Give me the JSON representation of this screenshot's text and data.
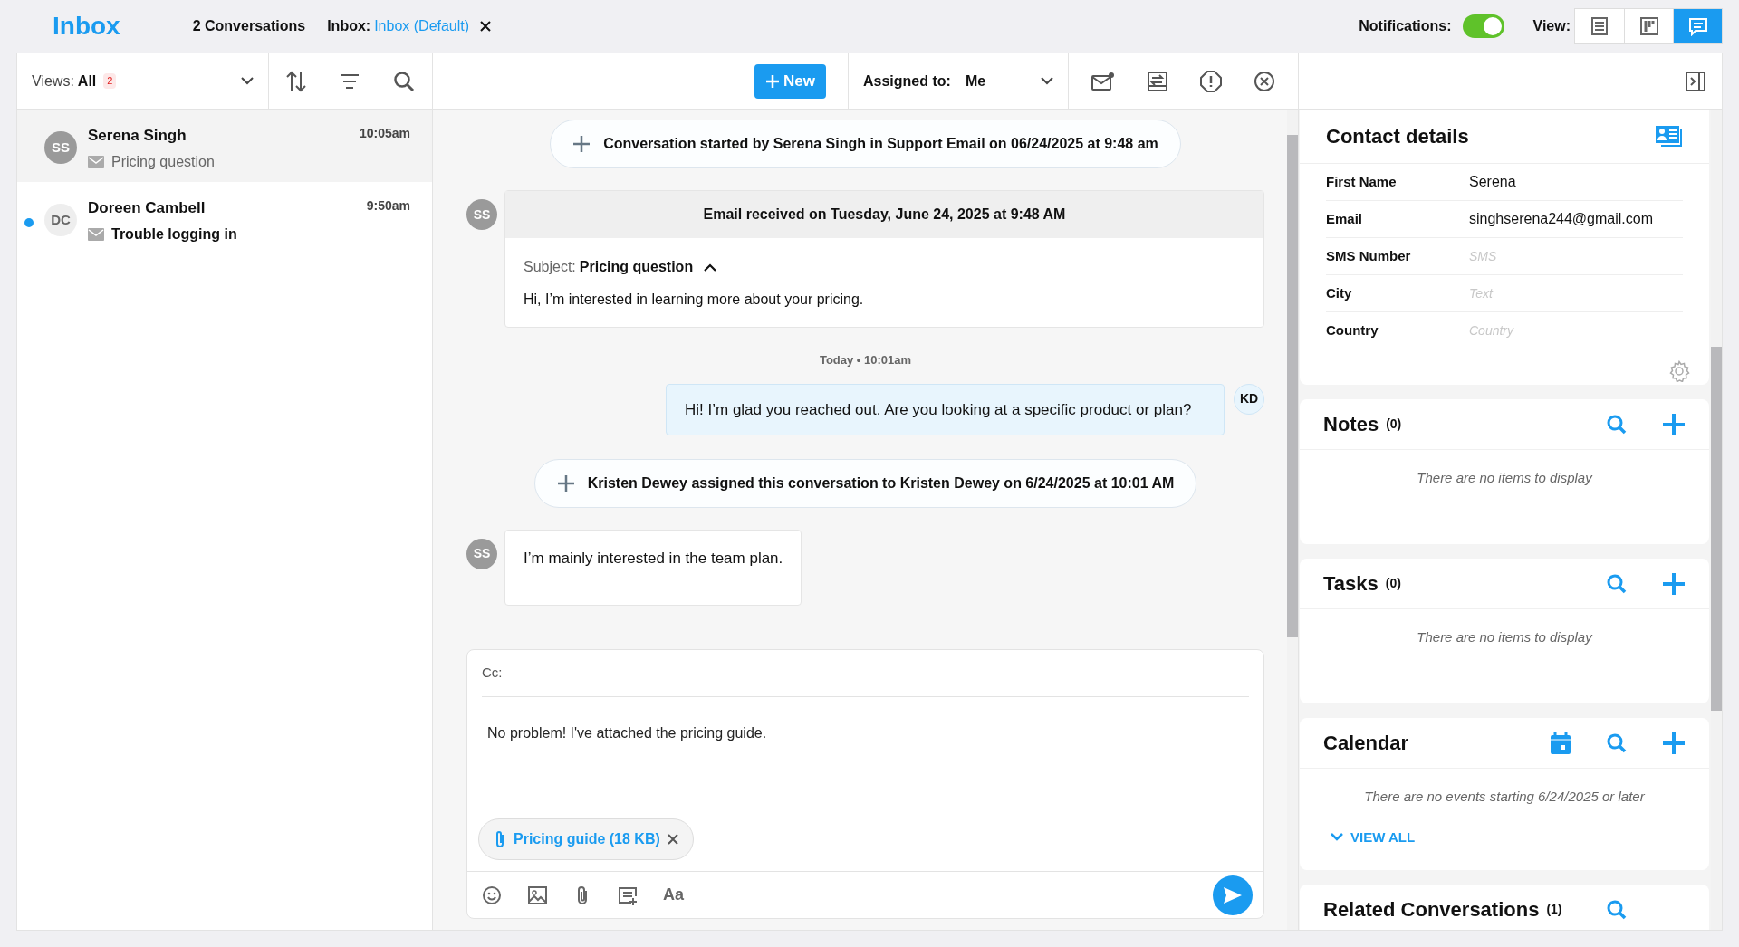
{
  "header": {
    "title": "Inbox",
    "count": "2 Conversations",
    "inbox_label": "Inbox:",
    "inbox_value": "Inbox (Default)",
    "notifications_label": "Notifications:",
    "notifications_on": true,
    "view_label": "View:",
    "views": [
      {
        "kind": "list",
        "selected": false
      },
      {
        "kind": "board",
        "selected": false
      },
      {
        "kind": "chat",
        "selected": true
      }
    ]
  },
  "list_toolbar": {
    "views_label": "Views:",
    "views_value": "All",
    "badge": "2"
  },
  "conversations": [
    {
      "initials": "SS",
      "name": "Serena Singh",
      "time": "10:05am",
      "subject": "Pricing question",
      "unread": false,
      "selected": true
    },
    {
      "initials": "DC",
      "name": "Doreen Cambell",
      "time": "9:50am",
      "subject": "Trouble logging in",
      "unread": true,
      "selected": false
    }
  ],
  "toolbar": {
    "new_label": "New",
    "assigned_label": "Assigned to:",
    "assigned_value": "Me"
  },
  "messages": [
    {
      "kind": "event",
      "text": "Conversation started by Serena Singh in Support Email on 06/24/2025 at 9:48 am"
    },
    {
      "kind": "email",
      "initials": "SS",
      "header": "Email received on Tuesday, June 24, 2025 at 9:48 AM",
      "subject_label": "Subject:",
      "subject": "Pricing question",
      "body": "Hi, I’m interested in learning more about your pricing."
    },
    {
      "kind": "timestamp",
      "text": "Today • 10:01am"
    },
    {
      "kind": "outgoing",
      "initials": "KD",
      "text": "Hi! I’m glad you reached out. Are you looking at a specific product or plan?"
    },
    {
      "kind": "event",
      "text": "Kristen Dewey assigned this conversation to Kristen Dewey on 6/24/2025 at 10:01 AM"
    },
    {
      "kind": "incoming",
      "initials": "SS",
      "text": "I’m mainly interested in the team plan."
    }
  ],
  "composer": {
    "cc_label": "Cc:",
    "body": "No problem! I've attached the pricing guide.",
    "attachment": "Pricing guide (18 KB)",
    "tools": [
      {
        "kind": "emoji"
      },
      {
        "kind": "image"
      },
      {
        "kind": "attach"
      },
      {
        "kind": "template"
      },
      {
        "kind": "format",
        "label": "Aa"
      }
    ]
  },
  "contact": {
    "title": "Contact details",
    "fields": [
      {
        "label": "First Name",
        "value": "Serena"
      },
      {
        "label": "Email",
        "value": "singhserena244@gmail.com"
      },
      {
        "label": "SMS Number",
        "placeholder": "SMS"
      },
      {
        "label": "City",
        "placeholder": "Text"
      },
      {
        "label": "Country",
        "placeholder": "Country"
      }
    ]
  },
  "panels": [
    {
      "kind": "notes",
      "title": "Notes",
      "count": "(0)",
      "empty": "There are no items to display"
    },
    {
      "kind": "tasks",
      "title": "Tasks",
      "count": "(0)",
      "empty": "There are no items to display"
    },
    {
      "kind": "calendar",
      "title": "Calendar",
      "empty": "There are no events starting 6/24/2025 or later",
      "view_all": "VIEW ALL"
    },
    {
      "kind": "related",
      "title": "Related Conversations",
      "count": "(1)"
    }
  ]
}
